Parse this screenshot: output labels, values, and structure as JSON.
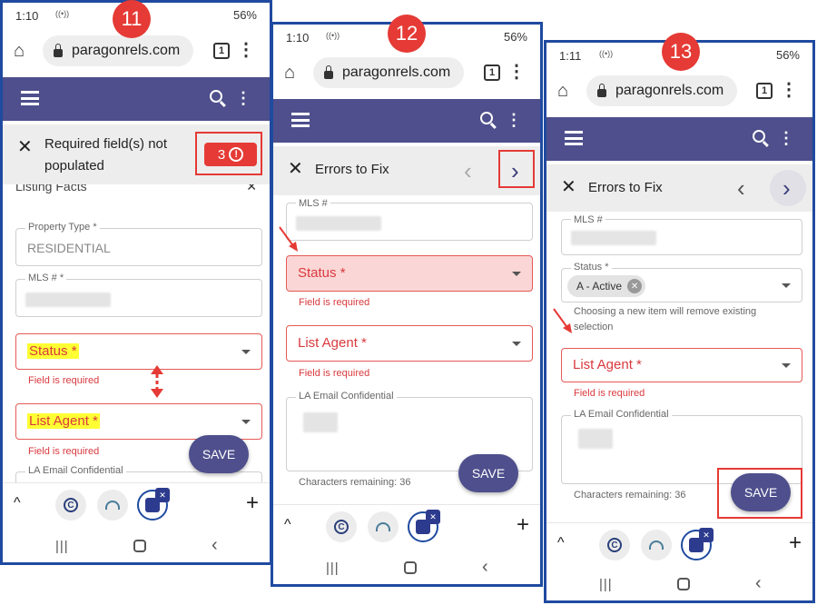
{
  "colors": {
    "frame": "#1f4aa0",
    "appbar": "#4e4f8c",
    "error": "#e53a35",
    "highlight": "#ffff33"
  },
  "browser": {
    "url": "paragonrels.com",
    "tab_count": "1",
    "battery": "56%"
  },
  "screens": [
    {
      "step": "11",
      "time": "1:10",
      "error_message": "Required field(s) not populated",
      "error_count": "3",
      "section_heading": "Listing Facts",
      "fields": {
        "property_type_label": "Property Type *",
        "property_type_value": "RESIDENTIAL",
        "mls_label": "MLS # *",
        "status_label": "Status *",
        "list_agent_label": "List Agent *",
        "la_email_label": "LA Email Confidential"
      },
      "status_error": "Field is required",
      "list_agent_error": "Field is required",
      "save_label": "SAVE"
    },
    {
      "step": "12",
      "time": "1:10",
      "errors_title": "Errors to Fix",
      "fields": {
        "mls_label": "MLS #",
        "status_label": "Status *",
        "list_agent_label": "List Agent *",
        "la_email_label": "LA Email Confidential"
      },
      "status_error": "Field is required",
      "list_agent_error": "Field is required",
      "chars_remaining": "Characters remaining: 36",
      "save_label": "SAVE"
    },
    {
      "step": "13",
      "time": "1:11",
      "errors_title": "Errors to Fix",
      "fields": {
        "mls_label": "MLS #",
        "status_label": "Status *",
        "status_chip": "A - Active",
        "list_agent_label": "List Agent *",
        "la_email_label": "LA Email Confidential"
      },
      "status_note": "Choosing a new item will remove existing selection",
      "list_agent_error": "Field is required",
      "chars_remaining": "Characters remaining: 36",
      "save_label": "SAVE"
    }
  ],
  "icons": [
    "home-icon",
    "lock-icon",
    "tabs-icon",
    "more-icon",
    "menu-icon",
    "search-icon",
    "close-icon",
    "alert-icon",
    "chevron-left-icon",
    "chevron-right-icon",
    "chevron-up-icon",
    "plus-icon",
    "recents-icon",
    "home-nav-icon",
    "back-icon"
  ]
}
